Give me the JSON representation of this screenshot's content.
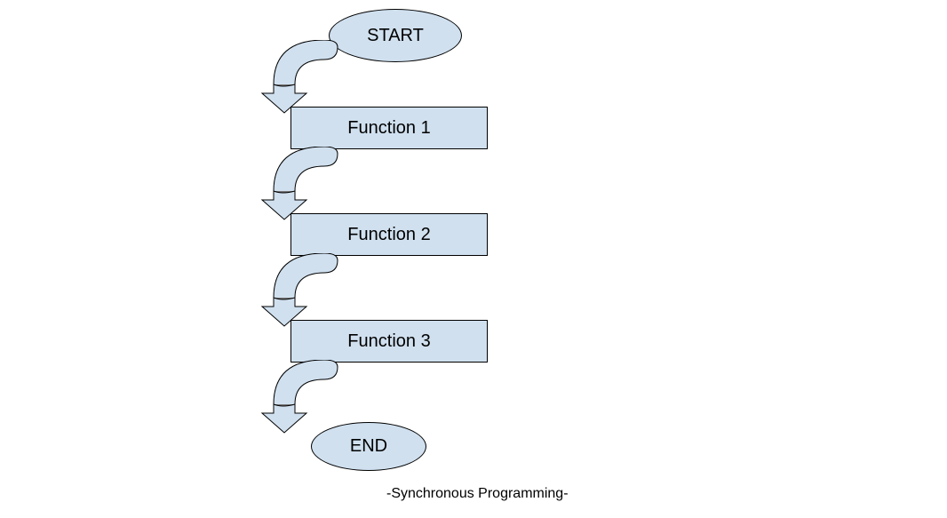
{
  "diagram": {
    "start": "START",
    "end": "END",
    "functions": {
      "f1": "Function 1",
      "f2": "Function 2",
      "f3": "Function 3"
    },
    "caption": "-Synchronous Programming-"
  }
}
